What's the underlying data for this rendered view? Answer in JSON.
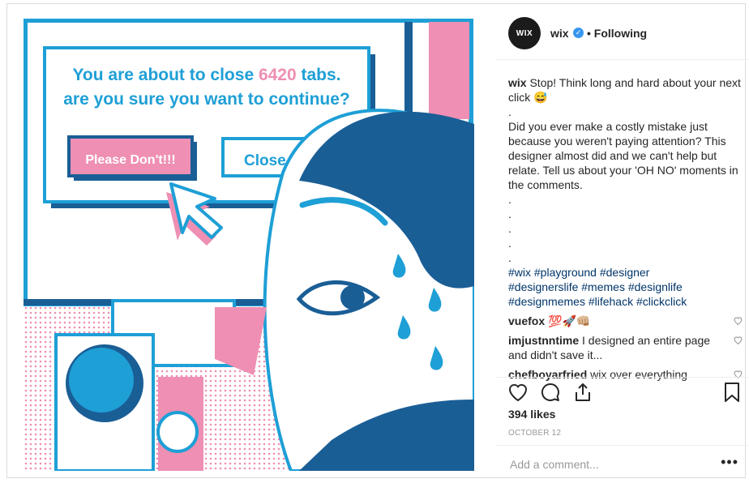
{
  "colors": {
    "blue": "#1e9fd6",
    "navy": "#1a5e96",
    "pink": "#ee8fb3",
    "link": "#003569"
  },
  "artwork": {
    "line1_prefix": "You are about to close ",
    "line1_number": "6420",
    "line1_suffix": " tabs.",
    "line2": "are you sure you want to continue?",
    "button_primary": "Please Don't!!!",
    "button_secondary": "Close T"
  },
  "post": {
    "author": "wix",
    "avatar_text": "WIX",
    "follow_status": "• Following",
    "caption_user": "wix",
    "caption_text": "Stop! Think long and hard about your next click 😅\n.\nDid you ever make a costly mistake just because you weren't paying attention? This designer almost did and we can't help but relate. Tell us about your 'OH NO' moments in the comments.\n.\n.\n.\n.\n.",
    "hashtags_line1": "#wix #playground #designer",
    "hashtags_line2": "#designerslife #memes #designlife",
    "hashtags_line3": "#designmemes #lifehack #clickclick",
    "comments": [
      {
        "user": "vuefox",
        "text": "💯🚀👊🏼"
      },
      {
        "user": "imjustnntime",
        "text": "I designed an entire page and didn't save it..."
      },
      {
        "user": "chefboyarfried",
        "text": "wix over everything"
      }
    ],
    "likes": "394 likes",
    "date": "OCTOBER 12",
    "comment_placeholder": "Add a comment...",
    "more_label": "•••"
  },
  "icons": [
    "heart-icon",
    "comment-icon",
    "share-icon",
    "bookmark-icon",
    "verified-icon"
  ]
}
